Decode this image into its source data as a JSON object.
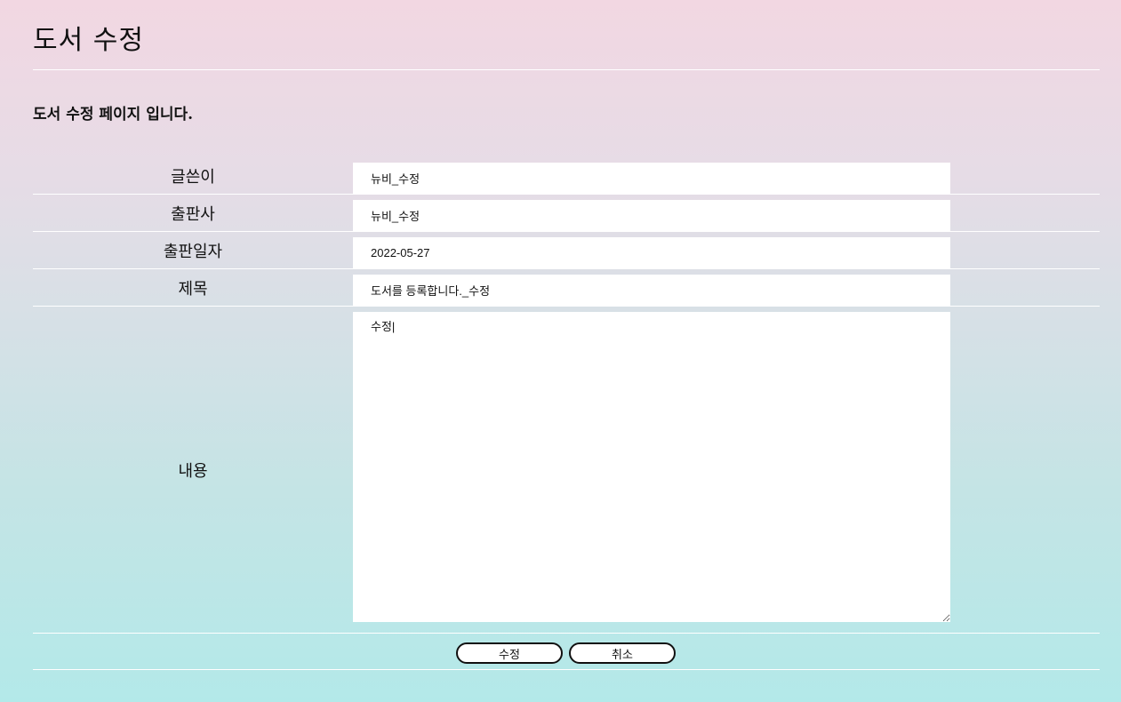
{
  "page": {
    "title": "도서 수정",
    "description": "도서 수정 페이지 입니다."
  },
  "form": {
    "writer": {
      "label": "글쓴이",
      "value": "뉴비_수정"
    },
    "publisher": {
      "label": "출판사",
      "value": "뉴비_수정"
    },
    "publish_date": {
      "label": "출판일자",
      "value": "2022-05-27"
    },
    "book_title": {
      "label": "제목",
      "value": "도서를 등록합니다._수정"
    },
    "content": {
      "label": "내용",
      "value": "수정|"
    }
  },
  "buttons": {
    "submit_label": "수정",
    "cancel_label": "취소"
  }
}
